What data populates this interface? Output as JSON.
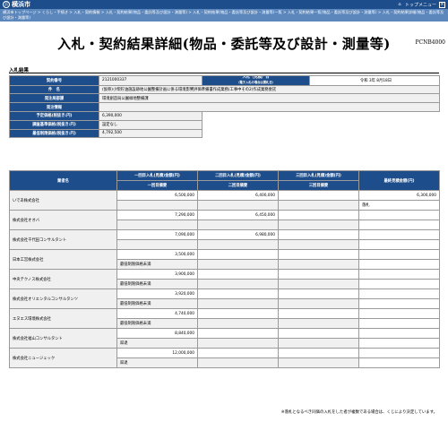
{
  "header": {
    "logo_mark": "浜",
    "logo_text": "横浜市",
    "top_menu_label": "トップメニュー",
    "close_glyph": "×"
  },
  "breadcrumbs": "横浜市トップページ > くらし・手続き > 入札・契約情報 > 入札・契約結果(物品・委託等及び設計・測量等) > 入札・契約結果(物品・委託等及び設計・測量等)一覧 > 入札・契約結果一覧(物品・委託等及び設計・測量等) > 入札・契約結果詳細(物品・委託等及び設計・測量等)",
  "page": {
    "title": "入札・契約結果詳細(物品・委託等及び設計・測量等)",
    "id": "PCNB4000",
    "section_heading": "入札結果",
    "footnote": "※落札となるべき同価の入札をした者が複数である場合は、くじにより決定しています。"
  },
  "info": {
    "contract_no_label": "契約番号",
    "contract_no": "2121000337",
    "bid_date_label": "入札（見積）日",
    "bid_date_sub": "（電子入札の場合は開札日）",
    "bid_date": "令和 3年 8月18日",
    "item_label": "件　名",
    "item": "(仮称)小柴貯油施設跡地公園整備計画に係る環境影響評価準備書作成業務(工事中その2)作成業務委託",
    "dept_label": "発注局部課",
    "dept": "環境創造局公園緑地整備課",
    "notes_label": "発注情報",
    "notes": "",
    "estimate_label": "予定価格(税抜き:円)",
    "estimate": "6,390,000",
    "survey_label": "調査基準価格(税抜き:円)",
    "survey": "設定なし",
    "min_label": "最低制限価格(税抜き:円)",
    "min": "4,792,500"
  },
  "bid_table": {
    "headers": {
      "company": "業者名",
      "round1": "一回目入札(見積)金額(円)",
      "round2": "二回目入札(見積)金額(円)",
      "round3": "三回目入札(見積)金額(円)",
      "final": "最終見積金額(円)",
      "round1_note": "一回目摘要",
      "round2_note": "二回目摘要",
      "round3_note": "三回目摘要"
    },
    "rows": [
      {
        "company": "いであ株式会社",
        "r1": "6,500,000",
        "r2": "6,400,000",
        "r3": "",
        "final": "6,300,000",
        "n1": "",
        "n2": "",
        "n3": "",
        "nf": "落札"
      },
      {
        "company": "株式会社オオバ",
        "r1": "7,290,000",
        "r2": "6,450,000",
        "r3": "",
        "final": "",
        "n1": "",
        "n2": "",
        "n3": "",
        "nf": ""
      },
      {
        "company": "株式会社千代田コンサルタント",
        "r1": "7,090,000",
        "r2": "6,980,000",
        "r3": "",
        "final": "",
        "n1": "",
        "n2": "",
        "n3": "",
        "nf": ""
      },
      {
        "company": "日本工営株式会社",
        "r1": "3,500,000",
        "r2": "",
        "r3": "",
        "final": "",
        "n1": "最低制限価格未満",
        "n2": "",
        "n3": "",
        "nf": ""
      },
      {
        "company": "中央テクノス株式会社",
        "r1": "3,900,000",
        "r2": "",
        "r3": "",
        "final": "",
        "n1": "最低制限価格未満",
        "n2": "",
        "n3": "",
        "nf": ""
      },
      {
        "company": "株式会社オリエンタルコンサルタンツ",
        "r1": "3,920,000",
        "r2": "",
        "r3": "",
        "final": "",
        "n1": "最低制限価格未満",
        "n2": "",
        "n3": "",
        "nf": ""
      },
      {
        "company": "エヌエス環境株式会社",
        "r1": "4,740,000",
        "r2": "",
        "r3": "",
        "final": "",
        "n1": "最低制限価格未満",
        "n2": "",
        "n3": "",
        "nf": ""
      },
      {
        "company": "株式会社福山コンサルタント",
        "r1": "8,840,000",
        "r2": "",
        "r3": "",
        "final": "",
        "n1": "辞退",
        "n2": "",
        "n3": "",
        "nf": ""
      },
      {
        "company": "株式会社ニュージェック",
        "r1": "12,000,000",
        "r2": "",
        "r3": "",
        "final": "",
        "n1": "辞退",
        "n2": "",
        "n3": "",
        "nf": ""
      }
    ]
  }
}
